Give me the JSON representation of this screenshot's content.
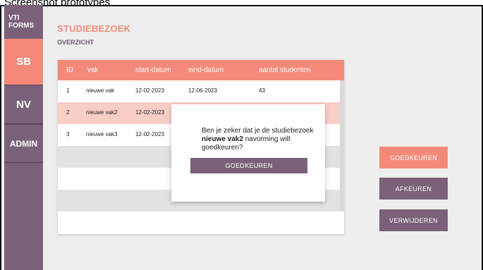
{
  "caption": "Screenshot prototypes",
  "sidebar": {
    "brand_line1": "VTI",
    "brand_line2": "FORMS",
    "items": [
      {
        "label": "SB"
      },
      {
        "label": "NV"
      },
      {
        "label": "ADMIN"
      }
    ]
  },
  "page": {
    "title": "STUDIEBEZOEK",
    "subtitle": "OVERZICHT"
  },
  "table": {
    "columns": [
      "ID",
      "vak",
      "start-datum",
      "eind-datum",
      "aantal studenten"
    ],
    "rows": [
      {
        "id": "1",
        "vak": "nieuwe vak",
        "start": "12-02-2023",
        "eind": "12-06-2023",
        "aantal": "43"
      },
      {
        "id": "2",
        "vak": "nieuwe vak2",
        "start": "12-02-2023"
      },
      {
        "id": "3",
        "vak": "nieuwe vak3",
        "start": "12-02-2023"
      }
    ]
  },
  "modal": {
    "text_before": "Ben je zeker dat je de studiebezoek ",
    "text_bold": "nieuwe vak2",
    "text_after": " navorming wilt goedkeuren?",
    "confirm_label": "GOEDKEUREN"
  },
  "actions": {
    "approve_label": "GOEDKEUREN",
    "reject_label": "AFKEUREN",
    "delete_label": "VERWIJDEREN"
  },
  "colors": {
    "accent": "#f4897a",
    "primary": "#7a6079",
    "selected_row": "#f9cec7"
  }
}
